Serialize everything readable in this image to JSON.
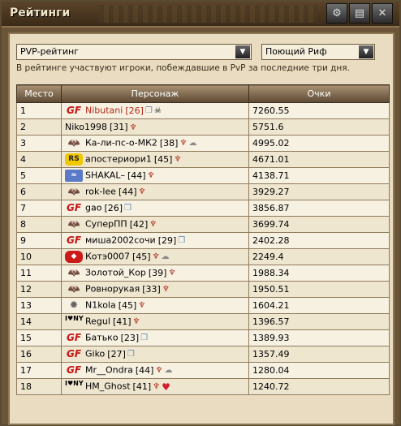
{
  "window": {
    "title": "Рейтинги",
    "buttons": [
      "⚙",
      "▤",
      "✕"
    ]
  },
  "filters": {
    "rating_type": "PVP-рейтинг",
    "location": "Поющий Риф",
    "dropdown_arrow": "▼"
  },
  "info_text": "В рейтинге участвуют игроки, побеждавшие в PvP за последние три дня.",
  "table": {
    "headers": [
      "Место",
      "Персонаж",
      "Очки"
    ],
    "rows": [
      {
        "place": "1",
        "clan": "gf",
        "clan_glyph": "GF",
        "nick": "Nibutani",
        "level": "[26]",
        "red": true,
        "badges": [
          "gift",
          "skull"
        ],
        "score": "7260.55"
      },
      {
        "place": "2",
        "clan": "",
        "clan_glyph": "",
        "nick": "Niko1998",
        "level": "[31]",
        "red": false,
        "badges": [
          "bird"
        ],
        "score": "5751.6"
      },
      {
        "place": "3",
        "clan": "bat",
        "clan_glyph": "🦇",
        "nick": "Ка-ли-пс-о-МК2",
        "level": "[38]",
        "red": false,
        "badges": [
          "bird",
          "cloud"
        ],
        "score": "4995.02"
      },
      {
        "place": "4",
        "clan": "rs",
        "clan_glyph": "RS",
        "nick": "апостериори1",
        "level": "[45]",
        "red": false,
        "badges": [
          "bird"
        ],
        "score": "4671.01"
      },
      {
        "place": "5",
        "clan": "shark",
        "clan_glyph": "≈",
        "nick": "SHAKAL–",
        "level": "[44]",
        "red": false,
        "badges": [
          "bird"
        ],
        "score": "4138.71"
      },
      {
        "place": "6",
        "clan": "bat",
        "clan_glyph": "🦇",
        "nick": "rok-lee",
        "level": "[44]",
        "red": false,
        "badges": [
          "bird"
        ],
        "score": "3929.27"
      },
      {
        "place": "7",
        "clan": "gf",
        "clan_glyph": "GF",
        "nick": "gao",
        "level": "[26]",
        "red": false,
        "badges": [
          "gift"
        ],
        "score": "3856.87"
      },
      {
        "place": "8",
        "clan": "bat",
        "clan_glyph": "🦇",
        "nick": "СуперПП",
        "level": "[42]",
        "red": false,
        "badges": [
          "bird"
        ],
        "score": "3699.74"
      },
      {
        "place": "9",
        "clan": "gf",
        "clan_glyph": "GF",
        "nick": "миша2002сочи",
        "level": "[29]",
        "red": false,
        "badges": [
          "gift"
        ],
        "score": "2402.28"
      },
      {
        "place": "10",
        "clan": "fish",
        "clan_glyph": "◆",
        "nick": "Котэ0007",
        "level": "[45]",
        "red": false,
        "badges": [
          "bird",
          "cloud"
        ],
        "score": "2249.4"
      },
      {
        "place": "11",
        "clan": "bat",
        "clan_glyph": "🦇",
        "nick": "Золотой_Кор",
        "level": "[39]",
        "red": false,
        "badges": [
          "bird"
        ],
        "score": "1988.34"
      },
      {
        "place": "12",
        "clan": "bat",
        "clan_glyph": "🦇",
        "nick": "Ровнорукая",
        "level": "[33]",
        "red": false,
        "badges": [
          "bird"
        ],
        "score": "1950.51"
      },
      {
        "place": "13",
        "clan": "gear",
        "clan_glyph": "✹",
        "nick": "N1kola",
        "level": "[45]",
        "red": false,
        "badges": [
          "bird"
        ],
        "score": "1604.21"
      },
      {
        "place": "14",
        "clan": "ny",
        "clan_glyph": "I♥NY",
        "nick": "Regul",
        "level": "[41]",
        "red": false,
        "badges": [
          "bird"
        ],
        "score": "1396.57"
      },
      {
        "place": "15",
        "clan": "gf",
        "clan_glyph": "GF",
        "nick": "Батько",
        "level": "[23]",
        "red": false,
        "badges": [
          "gift"
        ],
        "score": "1389.93"
      },
      {
        "place": "16",
        "clan": "gf",
        "clan_glyph": "GF",
        "nick": "Giko",
        "level": "[27]",
        "red": false,
        "badges": [
          "gift"
        ],
        "score": "1357.49"
      },
      {
        "place": "17",
        "clan": "gf",
        "clan_glyph": "GF",
        "nick": "Mr__Ondra",
        "level": "[44]",
        "red": false,
        "badges": [
          "bird",
          "cloud"
        ],
        "score": "1280.04"
      },
      {
        "place": "18",
        "clan": "ny",
        "clan_glyph": "I♥NY",
        "nick": "HM_Ghost",
        "level": "[41]",
        "red": false,
        "badges": [
          "bird",
          "heart"
        ],
        "score": "1240.72"
      }
    ]
  }
}
